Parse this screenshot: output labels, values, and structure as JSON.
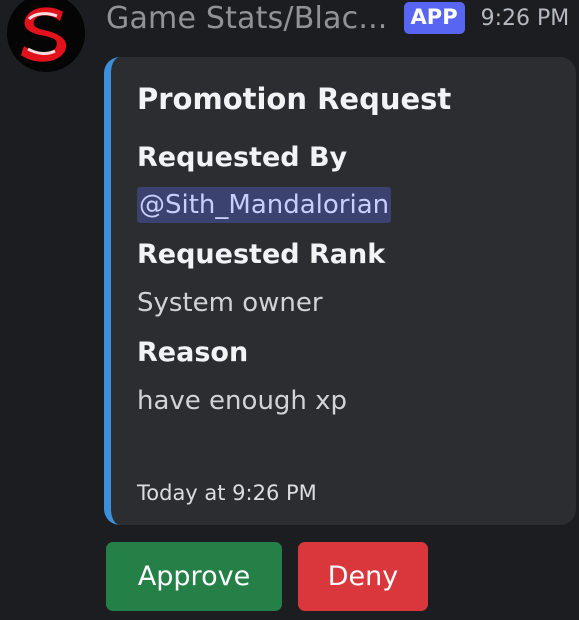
{
  "message": {
    "username": "Game Stats/Blac...",
    "badge": "APP",
    "time": "9:26 PM"
  },
  "embed": {
    "title": "Promotion Request",
    "fields": [
      {
        "name": "Requested By",
        "value": "@Sith_Mandalorian"
      },
      {
        "name": "Requested Rank",
        "value": "System owner"
      },
      {
        "name": "Reason",
        "value": "have enough xp"
      }
    ],
    "footer": "Today at 9:26 PM",
    "accent_color": "#3d8fd8"
  },
  "buttons": {
    "approve": "Approve",
    "deny": "Deny"
  },
  "colors": {
    "approve": "#248046",
    "deny": "#da373c",
    "badge": "#5865f2",
    "mention_bg": "#3b4270"
  },
  "avatar": {
    "icon": "red-s-logo-icon"
  }
}
